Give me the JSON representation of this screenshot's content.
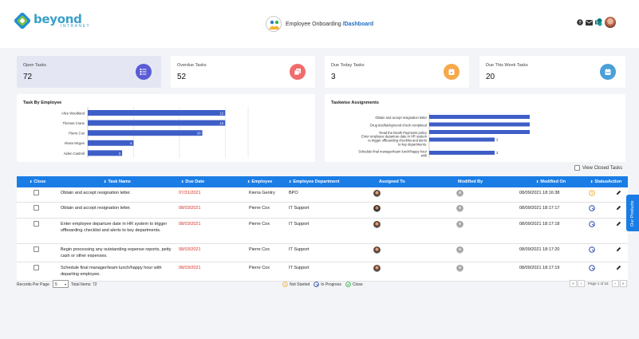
{
  "brand": {
    "name": "beyond",
    "sub": "INTRANET",
    "colors": {
      "primary": "#1a7de6",
      "red": "#f06b6b",
      "orange": "#f6a94a",
      "blue": "#4a9fd8",
      "purple": "#5b5bd6"
    }
  },
  "header": {
    "title_prefix": "Employee Onboarding ",
    "title_link": "/Dashboard",
    "icons": [
      "help-icon",
      "mail-icon",
      "sharepoint-icon",
      "avatar"
    ]
  },
  "stats": [
    {
      "label": "Open Tasks",
      "value": "72",
      "icon": "list-icon"
    },
    {
      "label": "Overdue Tasks",
      "value": "52",
      "icon": "copy-icon"
    },
    {
      "label": "Due Today Tasks",
      "value": "3",
      "icon": "calendar-icon"
    },
    {
      "label": "Due This Week Tasks",
      "value": "20",
      "icon": "calendar-week-icon"
    }
  ],
  "chart_data": [
    {
      "type": "bar",
      "title": "Task By Employee",
      "orientation": "horizontal",
      "categories": [
        "Alice Woodland",
        "Thomas Crane",
        "Pierre Cox",
        "Alvaro Mcgee",
        "Aiden Cantrell"
      ],
      "values": [
        12,
        12,
        10,
        4,
        3
      ],
      "grid": true
    },
    {
      "type": "bar",
      "title": "Taskwise Assignments",
      "orientation": "horizontal",
      "categories": [
        "Obtain and accept resignation letter",
        "Drug test/background check completed",
        "Read the Death Payments policy",
        "Enter employee departure date in HR system to trigger offboarding checklist and alerts to key departments.",
        "Schedule final manager/team lunch/happy hour with"
      ],
      "values": [
        null,
        null,
        null,
        2,
        2
      ],
      "grid": true
    }
  ],
  "view_closed_label": "View Closed Tasks",
  "table": {
    "columns": [
      "Close",
      "Task Name",
      "Due Date",
      "Employee",
      "Employee Department",
      "Assigned To",
      "Modified By",
      "Modified On",
      "Status",
      "Action"
    ],
    "rows": [
      {
        "task": "Obtain and accept resignation letter.",
        "due": "07/31/2021",
        "employee": "Kierra Gentry",
        "dept": "BPO",
        "assigned": "face-man",
        "modified_by": "face-grey",
        "modified_on": "08/09/2021 18:16:38",
        "status": "not-started"
      },
      {
        "task": "Obtain and accept resignation letter.",
        "due": "08/03/2021",
        "employee": "Pierre Cox",
        "dept": "IT Support",
        "assigned": "face-man2",
        "modified_by": "face-grey",
        "modified_on": "08/09/2021 18:17:17",
        "status": "in-progress"
      },
      {
        "task": "Enter employee departure date in HR system to trigger offboarding checklist and alerts to key departments.",
        "due": "08/03/2021",
        "employee": "Pierre Cox",
        "dept": "IT Support",
        "assigned": "face-man",
        "modified_by": "face-grey",
        "modified_on": "08/09/2021 18:17:18",
        "status": "in-progress"
      },
      {
        "task": "Begin processing any outstanding expense reports, petty cash or other expenses.",
        "due": "08/03/2021",
        "employee": "Pierre Cox",
        "dept": "IT Support",
        "assigned": "face-man",
        "modified_by": "face-grey",
        "modified_on": "08/09/2021 18:17:20",
        "status": "in-progress"
      },
      {
        "task": "Schedule final manager/team lunch/happy hour with departing employee.",
        "due": "08/03/2021",
        "employee": "Pierre Cox",
        "dept": "IT Support",
        "assigned": "face-man",
        "modified_by": "face-grey",
        "modified_on": "08/09/2021 18:17:19",
        "status": "in-progress"
      }
    ]
  },
  "footer": {
    "records_per_page_label": "Records Per Page",
    "records_per_page_value": "5",
    "total_items": "Total Items: 72",
    "legend": [
      "Not Started",
      "In Progress",
      "Close"
    ],
    "page_info": "Page 1 of 15"
  },
  "side_tab": "Our Products"
}
